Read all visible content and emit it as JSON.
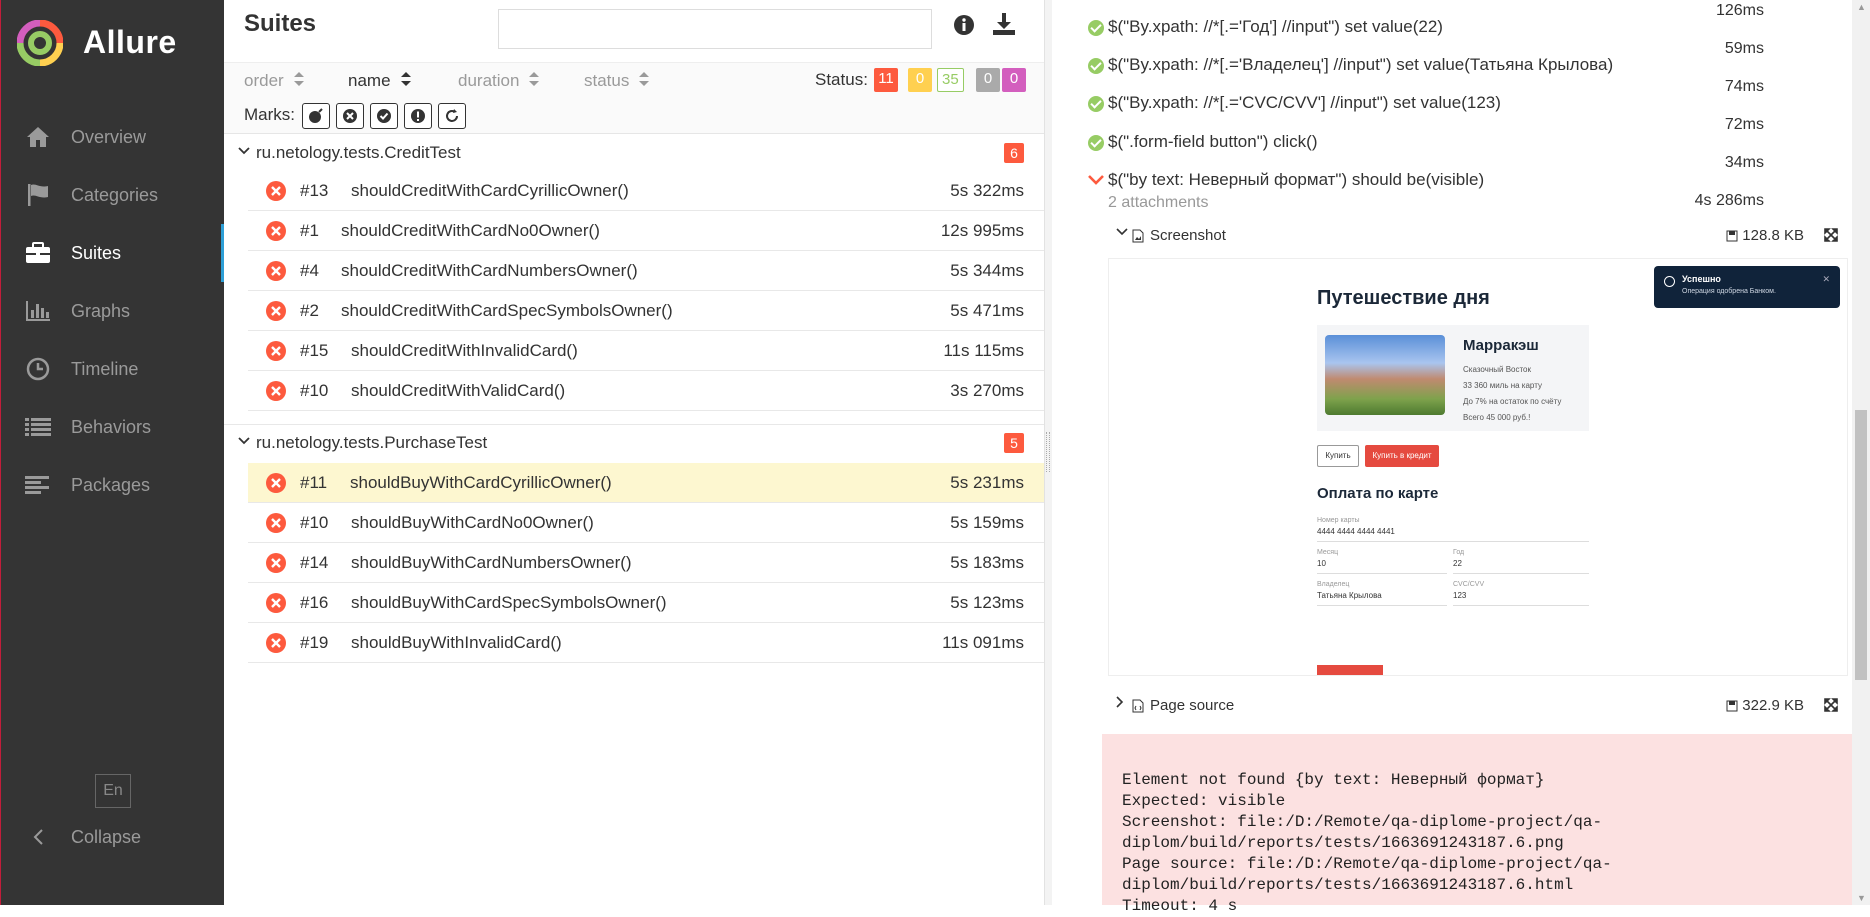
{
  "app": {
    "brand": "Allure"
  },
  "sidebar": {
    "items": [
      {
        "label": "Overview",
        "icon": "home-icon"
      },
      {
        "label": "Categories",
        "icon": "flag-icon"
      },
      {
        "label": "Suites",
        "icon": "briefcase-icon",
        "active": true
      },
      {
        "label": "Graphs",
        "icon": "bar-chart-icon"
      },
      {
        "label": "Timeline",
        "icon": "clock-icon"
      },
      {
        "label": "Behaviors",
        "icon": "list-icon"
      },
      {
        "label": "Packages",
        "icon": "align-left-icon"
      }
    ],
    "lang": "En",
    "collapse": "Collapse"
  },
  "suites": {
    "title": "Suites",
    "search_placeholder": "",
    "sorters": {
      "order": "order",
      "name": "name",
      "duration": "duration",
      "status": "status"
    },
    "status_label": "Status:",
    "status_counts": {
      "failed": "11",
      "broken": "0",
      "passed": "35",
      "skipped": "0",
      "unknown": "0"
    },
    "marks_label": "Marks:",
    "groups": [
      {
        "name": "ru.netology.tests.CreditTest",
        "count": "6",
        "tests": [
          {
            "num": "#13",
            "name": "shouldCreditWithCardCyrillicOwner()",
            "duration": "5s 322ms"
          },
          {
            "num": "#1",
            "name": "shouldCreditWithCardNo0Owner()",
            "duration": "12s 995ms"
          },
          {
            "num": "#4",
            "name": "shouldCreditWithCardNumbersOwner()",
            "duration": "5s 344ms"
          },
          {
            "num": "#2",
            "name": "shouldCreditWithCardSpecSymbolsOwner()",
            "duration": "5s 471ms"
          },
          {
            "num": "#15",
            "name": "shouldCreditWithInvalidCard()",
            "duration": "11s 115ms"
          },
          {
            "num": "#10",
            "name": "shouldCreditWithValidCard()",
            "duration": "3s 270ms"
          }
        ]
      },
      {
        "name": "ru.netology.tests.PurchaseTest",
        "count": "5",
        "tests": [
          {
            "num": "#11",
            "name": "shouldBuyWithCardCyrillicOwner()",
            "duration": "5s 231ms"
          },
          {
            "num": "#10",
            "name": "shouldBuyWithCardNo0Owner()",
            "duration": "5s 159ms"
          },
          {
            "num": "#14",
            "name": "shouldBuyWithCardNumbersOwner()",
            "duration": "5s 183ms"
          },
          {
            "num": "#16",
            "name": "shouldBuyWithCardSpecSymbolsOwner()",
            "duration": "5s 123ms"
          },
          {
            "num": "#19",
            "name": "shouldBuyWithInvalidCard()",
            "duration": "11s 091ms"
          }
        ]
      }
    ]
  },
  "detail": {
    "steps": [
      {
        "text": "$(\"By.xpath: //*[.='Год'] //input\") set value(22)",
        "status": "passed"
      },
      {
        "text": "$(\"By.xpath: //*[.='Владелец'] //input\") set value(Татьяна Крылова)",
        "status": "passed"
      },
      {
        "text": "$(\"By.xpath: //*[.='CVC/CVV'] //input\") set value(123)",
        "status": "passed"
      },
      {
        "text": "$(\".form-field button\") click()",
        "status": "passed"
      },
      {
        "text": "$(\"by text: Неверный формат\") should be(visible)",
        "status": "failed"
      }
    ],
    "durations": [
      "126ms",
      "59ms",
      "74ms",
      "72ms",
      "34ms",
      "4s 286ms"
    ],
    "attachments_label": "2 attachments",
    "attachments": [
      {
        "name": "Screenshot",
        "size": "128.8 KB"
      },
      {
        "name": "Page source",
        "size": "322.9 KB"
      }
    ],
    "screenshot": {
      "title": "Путешествие дня",
      "city": "Марракэш",
      "list": [
        "Сказочный Восток",
        "33 360 миль на карту",
        "До 7% на остаток по счёту",
        "Всего 45 000 руб.!"
      ],
      "btn_buy": "Купить",
      "btn_credit": "Купить в кредит",
      "form_title": "Оплата по карте",
      "card_label": "Номер карты",
      "card_value": "4444 4444 4444 4441",
      "month_label": "Месяц",
      "month_value": "10",
      "year_label": "Год",
      "year_value": "22",
      "owner_label": "Владелец",
      "owner_value": "Татьяна Крылова",
      "cvc_label": "CVC/CVV",
      "cvc_value": "123",
      "toast_title": "Успешно",
      "toast_text": "Операция одобрена Банком."
    },
    "error_text": "Element not found {by text: Неверный формат}\nExpected: visible\nScreenshot: file:/D:/Remote/qa-diplome-project/qa-\ndiplom/build/reports/tests/1663691243187.6.png\nPage source: file:/D:/Remote/qa-diplome-project/qa-\ndiplom/build/reports/tests/1663691243187.6.html\nTimeout: 4 s"
  },
  "colors": {
    "sidebar_bg": "#343434",
    "active_accent": "#2e9fd6",
    "failed": "#fd5a3e",
    "broken": "#ffd050",
    "passed": "#97cc64",
    "skipped": "#aaaaaa",
    "unknown": "#d35ebe",
    "selected_row": "#fdf7d0",
    "error_bg": "#fce1e1"
  }
}
